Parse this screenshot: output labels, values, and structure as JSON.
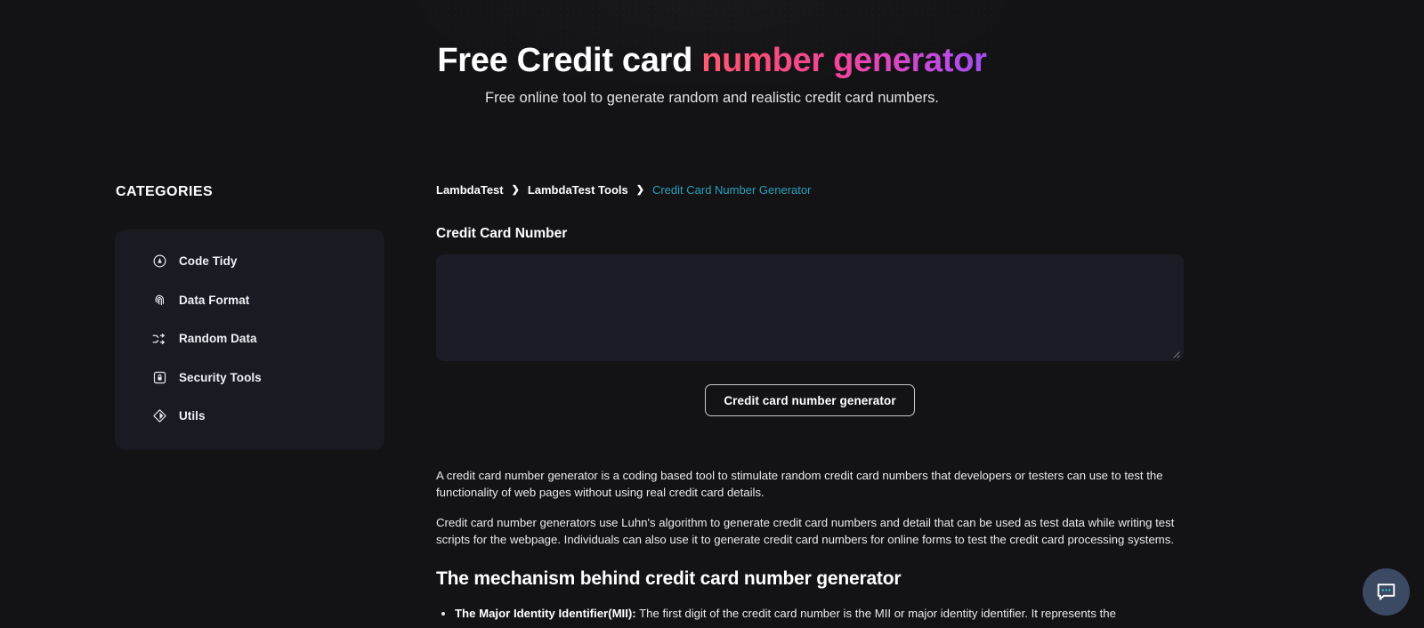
{
  "hero": {
    "title_plain": "Free Credit card ",
    "title_gradient": "number generator",
    "subtitle": "Free online tool to generate random and realistic credit card numbers.",
    "gradient_from": "#ff5c72",
    "gradient_to": "#a14ef0"
  },
  "sidebar": {
    "heading": "CATEGORIES",
    "items": [
      {
        "label": "Code Tidy",
        "icon": "code-tidy-icon"
      },
      {
        "label": "Data Format",
        "icon": "fingerprint-icon"
      },
      {
        "label": "Random Data",
        "icon": "shuffle-icon"
      },
      {
        "label": "Security Tools",
        "icon": "lock-icon"
      },
      {
        "label": "Utils",
        "icon": "diamond-icon"
      }
    ]
  },
  "breadcrumb": {
    "items": [
      {
        "label": "LambdaTest",
        "current": false
      },
      {
        "label": "LambdaTest Tools",
        "current": false
      },
      {
        "label": "Credit Card Number Generator",
        "current": true
      }
    ],
    "separator": "❯",
    "current_color": "#2aa1b8"
  },
  "form": {
    "field_label": "Credit Card Number",
    "output_value": "",
    "output_placeholder": "",
    "generate_button": "Credit card number generator"
  },
  "content": {
    "paragraphs": [
      "A credit card number generator is a coding based tool to stimulate random credit card numbers that developers or testers can use to test the functionality of web pages without using real credit card details.",
      "Credit card number generators use Luhn's algorithm to generate credit card numbers and detail that can be used as test data while writing test scripts for the webpage. Individuals can also use it to generate credit card numbers for online forms to test the credit card processing systems."
    ],
    "section_heading": "The mechanism behind credit card number generator",
    "bullets": [
      {
        "term": "The Major Identity Identifier(MII):",
        "text": " The first digit of the credit card number is the MII or major identity identifier. It represents the"
      }
    ]
  },
  "chat": {
    "icon": "chat-bubble-icon",
    "background_color": "#3b4963",
    "dot_color": "#2ec5c5"
  }
}
